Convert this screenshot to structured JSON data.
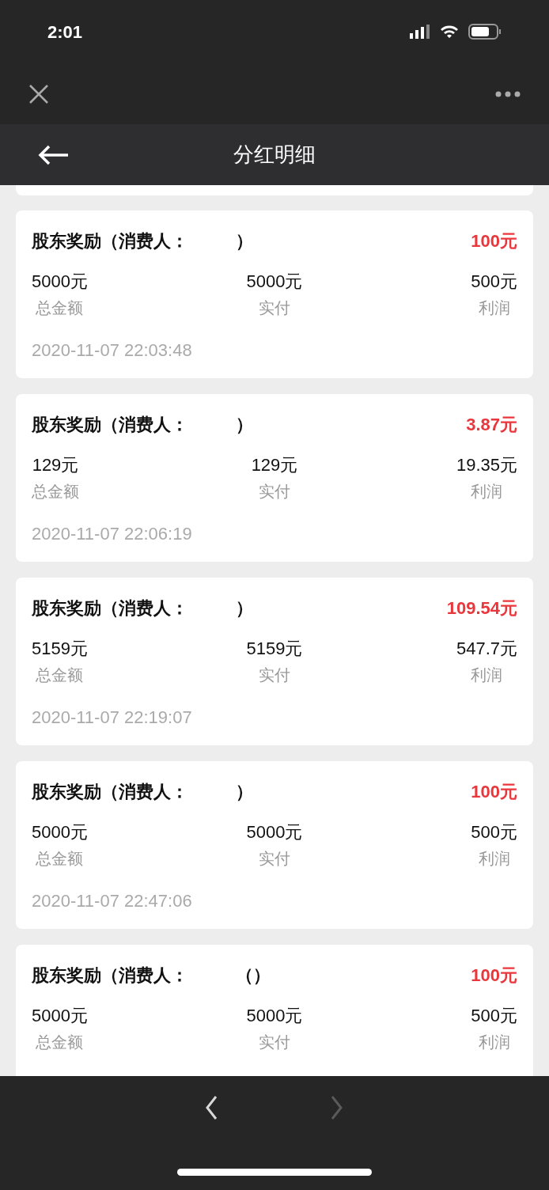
{
  "status_bar": {
    "time": "2:01"
  },
  "header": {
    "title": "分红明细"
  },
  "records": [
    {
      "title": "股东奖励（消费人：",
      "title_end": "）",
      "reward": "100元",
      "total": "5000元",
      "total_label": "总金额",
      "paid": "5000元",
      "paid_label": "实付",
      "profit": "500元",
      "profit_label": "利润",
      "time": "2020-11-07 22:03:48"
    },
    {
      "title": "股东奖励（消费人：",
      "title_end": "）",
      "reward": "3.87元",
      "total": "129元",
      "total_label": "总金额",
      "paid": "129元",
      "paid_label": "实付",
      "profit": "19.35元",
      "profit_label": "利润",
      "time": "2020-11-07 22:06:19"
    },
    {
      "title": "股东奖励（消费人：",
      "title_end": "）",
      "reward": "109.54元",
      "total": "5159元",
      "total_label": "总金额",
      "paid": "5159元",
      "paid_label": "实付",
      "profit": "547.7元",
      "profit_label": "利润",
      "time": "2020-11-07 22:19:07"
    },
    {
      "title": "股东奖励（消费人：",
      "title_end": "）",
      "reward": "100元",
      "total": "5000元",
      "total_label": "总金额",
      "paid": "5000元",
      "paid_label": "实付",
      "profit": "500元",
      "profit_label": "利润",
      "time": "2020-11-07 22:47:06"
    },
    {
      "title": "股东奖励（消费人：",
      "title_end": "（）",
      "reward": "100元",
      "total": "5000元",
      "total_label": "总金额",
      "paid": "5000元",
      "paid_label": "实付",
      "profit": "500元",
      "profit_label": "利润"
    }
  ],
  "bottom_nav": [
    {
      "kind": "back",
      "disabled": false
    },
    {
      "kind": "forward",
      "disabled": true
    }
  ]
}
